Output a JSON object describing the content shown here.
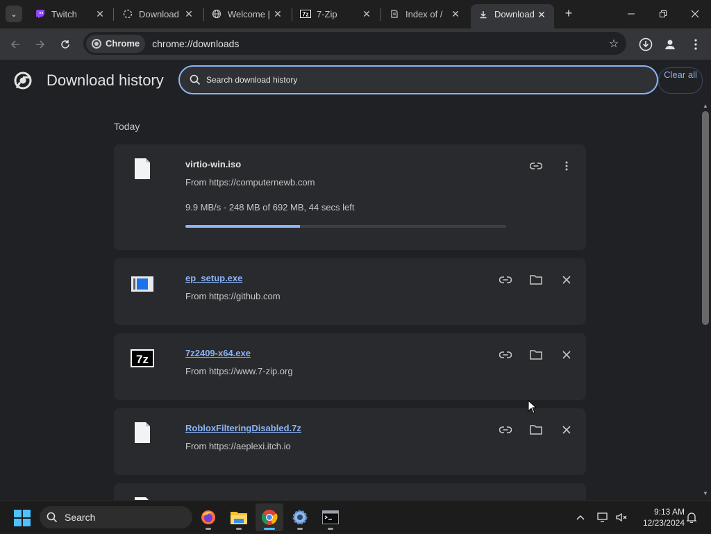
{
  "tabs": [
    {
      "label": "Twitch",
      "icon": "twitch-icon"
    },
    {
      "label": "Download",
      "icon": "loading-icon"
    },
    {
      "label": "Welcome |",
      "icon": "globe-icon"
    },
    {
      "label": "7-Zip",
      "icon": "7zip-icon"
    },
    {
      "label": "Index of /",
      "icon": "folder-icon"
    },
    {
      "label": "Download",
      "icon": "download-icon",
      "active": true
    }
  ],
  "toolbar": {
    "chip_label": "Chrome",
    "url": "chrome://downloads"
  },
  "header": {
    "title": "Download history",
    "search_placeholder": "Search download history",
    "clear_all": "Clear all"
  },
  "downloads": {
    "section_label": "Today",
    "items": [
      {
        "name": "virtio-win.iso",
        "source": "From https://computernewb.com",
        "status": "9.9 MB/s - 248 MB of 692 MB, 44 secs left",
        "progress": 0.358,
        "in_progress": true
      },
      {
        "name": "ep_setup.exe",
        "source": "From https://github.com",
        "in_progress": false
      },
      {
        "name": "7z2409-x64.exe",
        "source": "From https://www.7-zip.org",
        "in_progress": false
      },
      {
        "name": "RobloxFilteringDisabled.7z",
        "source": "From https://aeplexi.itch.io",
        "in_progress": false
      }
    ]
  },
  "taskbar": {
    "search_label": "Search",
    "time": "9:13 AM",
    "date": "12/23/2024"
  },
  "colors": {
    "accent": "#8ab4f8",
    "background": "#202124",
    "card": "#292a2d"
  }
}
